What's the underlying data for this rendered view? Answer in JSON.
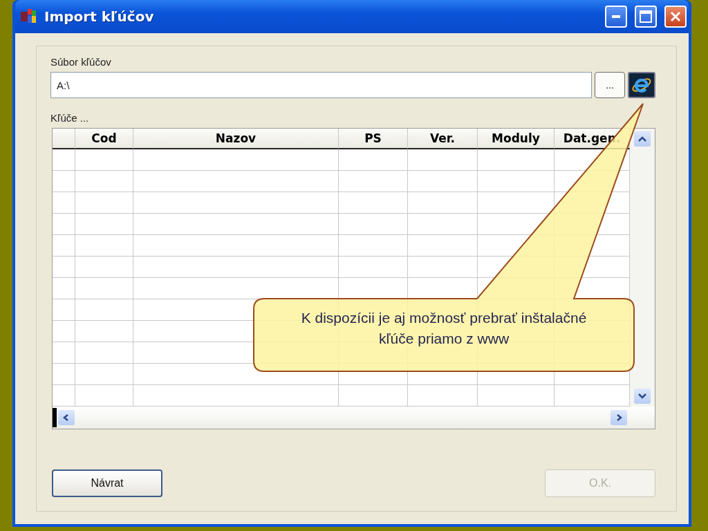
{
  "window": {
    "title": "Import kľúčov"
  },
  "file_field": {
    "label": "Súbor kľúčov",
    "value": "A:\\",
    "browse_button": "..."
  },
  "keys_label": "Kľúče ...",
  "table": {
    "columns": [
      "Cod",
      "Nazov",
      "PS",
      "Ver.",
      "Moduly",
      "Dat.gen."
    ]
  },
  "buttons": [
    {
      "label": "Návrat",
      "disabled": false
    },
    {
      "label": "O.K.",
      "disabled": true
    }
  ],
  "callout": {
    "text": "K dispozícii je aj možnosť prebrať inštalačné kľúče priamo z www"
  }
}
